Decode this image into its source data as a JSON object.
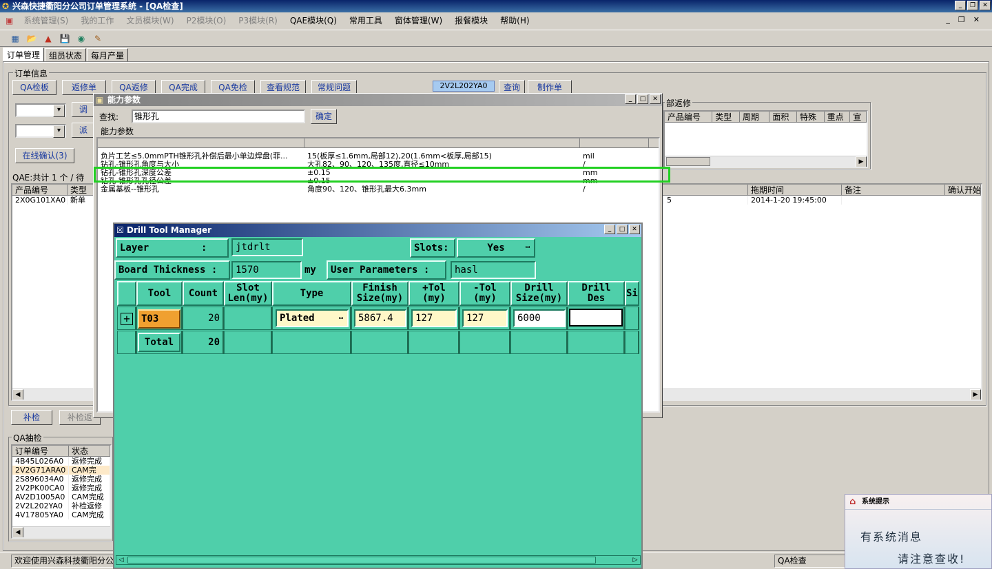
{
  "app": {
    "title": "兴森快捷衢阳分公司订单管理系统 - [QA检查]"
  },
  "menu": [
    {
      "label": "系统管理(S)",
      "enabled": false
    },
    {
      "label": "我的工作",
      "enabled": false
    },
    {
      "label": "文员模块(W)",
      "enabled": false
    },
    {
      "label": "P2模块(O)",
      "enabled": false
    },
    {
      "label": "P3模块(R)",
      "enabled": false
    },
    {
      "label": "QAE模块(Q)",
      "enabled": true
    },
    {
      "label": "常用工具",
      "enabled": true
    },
    {
      "label": "窗体管理(W)",
      "enabled": true
    },
    {
      "label": "报餐模块",
      "enabled": true
    },
    {
      "label": "帮助(H)",
      "enabled": true
    }
  ],
  "tabs": [
    "订单管理",
    "组员状态",
    "每月产量"
  ],
  "order_info": {
    "label": "订单信息",
    "buttons": [
      "QA检板",
      "返修单",
      "QA返修",
      "QA完成",
      "QA免检",
      "查看规范",
      "常规问题"
    ],
    "order_no_display": "2V2L202YA0",
    "query_btn": "查询",
    "make_btn": "制作单",
    "dispatch_btn1": "调",
    "dispatch_btn2": "派",
    "online_btn": "在线确认(3)",
    "rework_label": "部返修",
    "rework_headers": [
      "产品编号",
      "类型",
      "周期",
      "面积",
      "特殊",
      "重点",
      "宣"
    ],
    "qae_summary": "QAE:共计 1 个 / 待",
    "main_headers": [
      "产品编号",
      "类型"
    ],
    "main_rows": [
      [
        "2X0G101XA0",
        "新单"
      ]
    ],
    "right_headers": [
      "拖期时间",
      "备注",
      "确认开始"
    ],
    "right_rows": [
      [
        "5",
        "2014-1-20 19:45:00"
      ]
    ],
    "recheck_btn": "补检",
    "recheck_return_btn": "补检返"
  },
  "qa_sample": {
    "label": "QA抽检",
    "headers": [
      "订单编号",
      "状态"
    ],
    "rows": [
      [
        "4B45L026A0",
        "返修完成"
      ],
      [
        "2V2G71ARA0",
        "CAM完"
      ],
      [
        "2S896034A0",
        "返修完成"
      ],
      [
        "2V2PK00CA0",
        "返修完成"
      ],
      [
        "AV2D1005A0",
        "CAM完成"
      ],
      [
        "2V2L202YA0",
        "补检返修"
      ],
      [
        "4V17805YA0",
        "CAM完成"
      ]
    ]
  },
  "status": {
    "welcome": "欢迎使用兴森科技衢阳分公",
    "mode": "QA检查"
  },
  "capability": {
    "title": "能力参数",
    "search_label": "查找:",
    "search_value": "锥形孔",
    "ok_btn": "确定",
    "group_label": "能力参数",
    "rows": [
      [
        "负片工艺≤5.0mmPTH锥形孔补偿后最小单边焊盘(菲...",
        "15(板厚≤1.6mm,局部12),20(1.6mm<板厚,局部15)",
        "mil"
      ],
      [
        "钻孔-锥形孔角度与大小",
        "大孔82、90、120、135度,直径≤10mm",
        "/"
      ],
      [
        "钻孔-锥形孔深度公差",
        "±0.15",
        "mm"
      ],
      [
        "钻孔-锥形孔孔径公差",
        "±0.15",
        "mm"
      ],
      [
        "金属基板--锥形孔",
        "角度90、120、锥形孔最大6.3mm",
        "/"
      ]
    ]
  },
  "dtm": {
    "title": "Drill Tool Manager",
    "layer_label": "Layer         :",
    "layer_value": "jtdrlt",
    "slots_label": "Slots:",
    "slots_value": "Yes",
    "board_label": "Board Thickness :",
    "board_value": "1570",
    "board_unit": "my",
    "userparam_label": "User Parameters :",
    "userparam_value": "hasl",
    "headers": [
      "Tool",
      "Count",
      "Slot\nLen(my)",
      "Type",
      "Finish\nSize(my)",
      "+Tol\n(my)",
      "-Tol\n(my)",
      "Drill\nSize(my)",
      "Drill\nDes",
      "Si"
    ],
    "row": {
      "tool": "T03",
      "count": "20",
      "type": "Plated",
      "finish": "5867.4",
      "ptol": "127",
      "ntol": "127",
      "drill": "6000",
      "des": ""
    },
    "total": {
      "label": "Total",
      "count": "20"
    }
  },
  "notice": {
    "title": "系统提示",
    "line1": "有系统消息",
    "line2": "请注意查收!"
  }
}
